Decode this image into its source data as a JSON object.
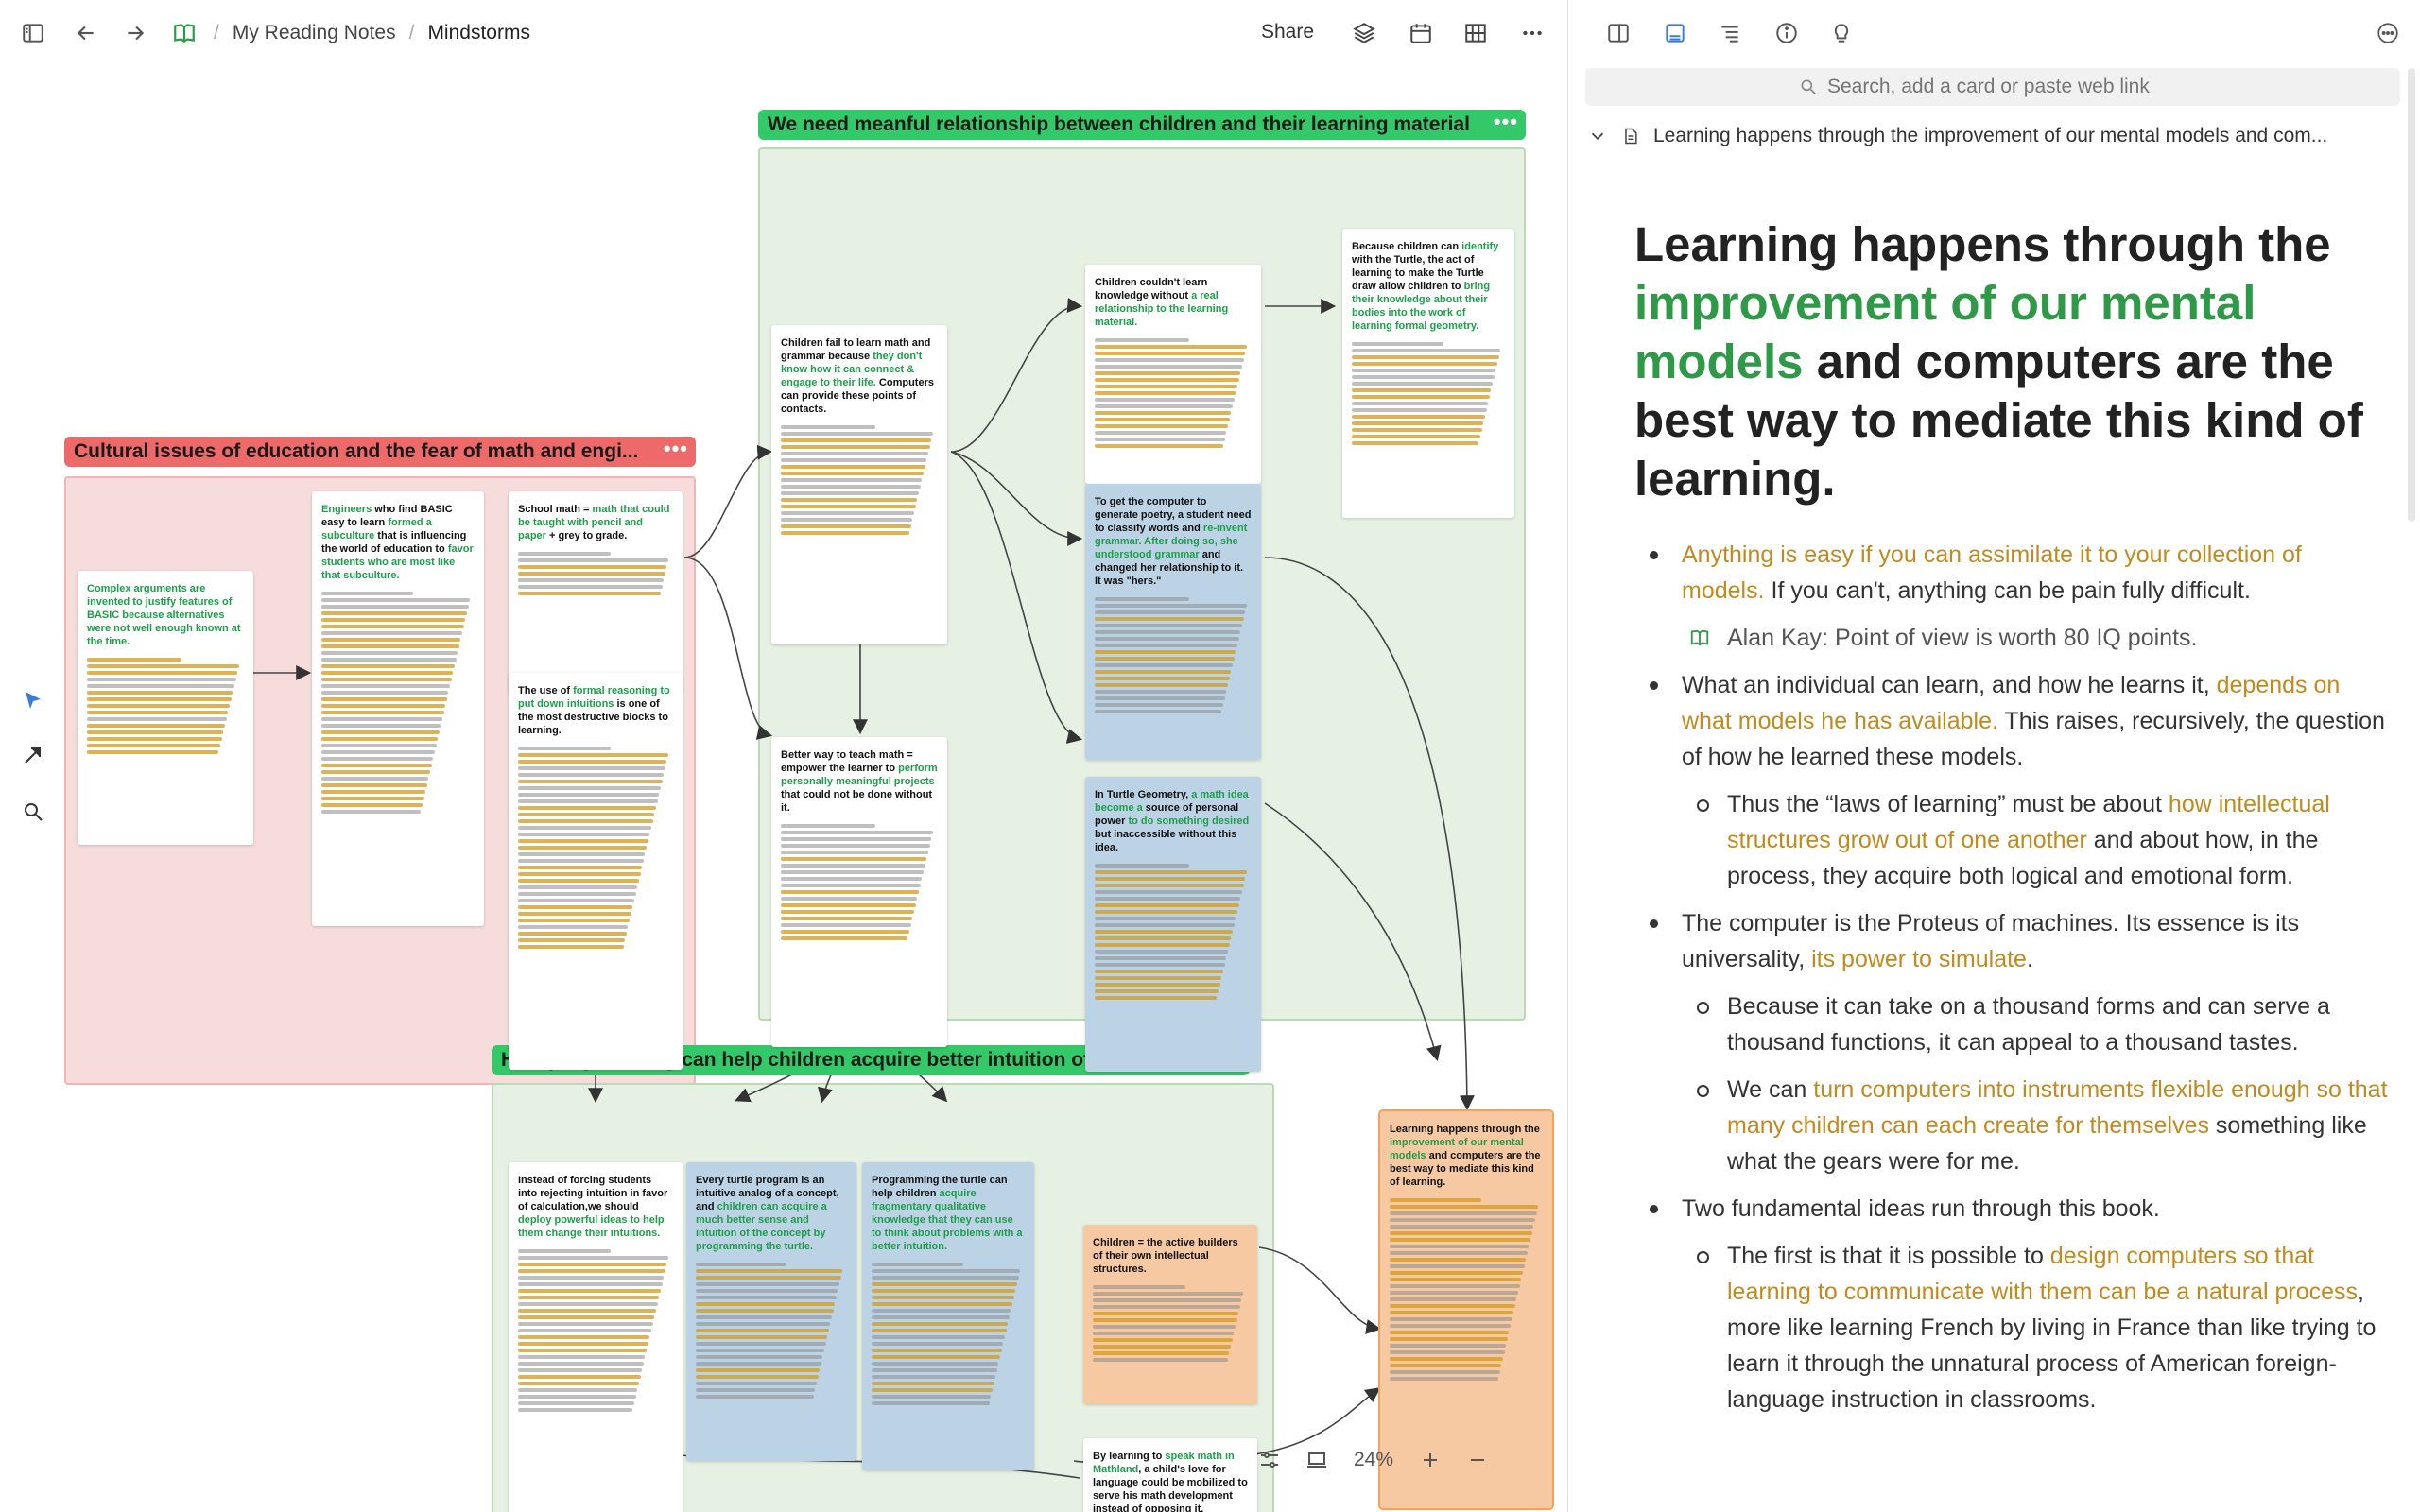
{
  "breadcrumb": {
    "root": "My Reading Notes",
    "current": "Mindstorms"
  },
  "toolbar": {
    "share_label": "Share"
  },
  "zoom": {
    "level": "24%"
  },
  "groups": {
    "relationship": "We need meanful relationship between children and their learning material",
    "cultural": "Cultural issues of education and the fear of math and engi...",
    "programming": "How programming can help children acquire better intuition of knowledge"
  },
  "cards": {
    "basic": [
      "Complex arguments are invented to justify features of BASIC because alternatives were not well enough known at the time."
    ],
    "engineers": [
      "Engineers",
      " who find BASIC easy to learn ",
      "formed a subculture",
      " that is influencing the world of education to ",
      "favor students who are most like that subculture."
    ],
    "school_math": [
      "School math = ",
      "math that could be taught with pencil and paper",
      " + grey to grade."
    ],
    "formal": [
      "The use of ",
      "formal reasoning to put down intuitions",
      " is one of the most destructive blocks to learning."
    ],
    "fail": [
      "Children fail to learn math and grammar because ",
      "they don't know how it can connect & engage to their life.",
      " Computers can provide these points of contacts."
    ],
    "better": [
      "Better way to teach math = empower the learner to ",
      "perform personally meaningful projects",
      " that could not be done without it."
    ],
    "couldnt": [
      "Children couldn't learn knowledge without ",
      "a real relationship to the learning material."
    ],
    "poetry": [
      "To get the computer to generate poetry, a student need to classify words and ",
      "re-invent grammar. After doing so, she understood grammar",
      " and changed her relationship to it. It was \"hers.\""
    ],
    "turtle_geo": [
      "In Turtle Geometry, ",
      "a math idea become a",
      " source of personal power ",
      "to do something desired",
      " but inaccessible without this idea."
    ],
    "identify": [
      "Because children can ",
      "identify",
      " with the Turtle, the act of learning to make the Turtle draw allow children to ",
      "bring their knowledge about their bodies into the work of learning formal geometry."
    ],
    "forcing": [
      "Instead of forcing students into rejecting intuition in favor of calculation,we should ",
      "deploy powerful ideas to help them change their intuitions."
    ],
    "turtle_prog": [
      "Every turtle program is an intuitive analog of a concept, and ",
      "children can acquire a much better sense and intuition of the concept by programming the turtle."
    ],
    "prog_turtle": [
      "Programming the turtle can help children ",
      "acquire fragmentary qualitative knowledge that they can use to think about problems with a better intuition."
    ],
    "builders": [
      "Children = the active builders of their own intellectual structures."
    ],
    "mathland": [
      "By learning to ",
      "speak math in Mathland",
      ", a child's love for language could be mobilized to serve his math development instead of opposing it."
    ],
    "learning_small": [
      "Learning happens through the ",
      "improvement of our mental models",
      " and computers are the best way to mediate this kind of learning."
    ]
  },
  "panel": {
    "search_placeholder": "Search, add a card or paste web link",
    "card_header": "Learning happens through the improvement of our mental models and com...",
    "title": {
      "t1": "Learning happens through the ",
      "t2": "improvement of our mental models",
      "t3": " and computers are the best way to mediate this kind of learning."
    },
    "b1": {
      "o": "Anything is easy if you can assimilate it to your collection of models.",
      "t": " If you can't, anything can be pain fully difficult."
    },
    "b1a": {
      "author": "Alan Kay",
      "t": ": Point of view is worth 80 IQ points."
    },
    "b2": {
      "t1": "What an individual can learn, and how he learns it, ",
      "o": "depends on what models he has available.",
      "t2": " This raises, recursively, the question of how he learned these models."
    },
    "b2a": {
      "t1": "Thus the “laws of learning” must be about ",
      "o": "how intellectual structures grow out of one another",
      "t2": " and about how, in the process, they acquire both logical and emotional form."
    },
    "b3": {
      "t1": "The computer is the Proteus of machines. Its essence is its universality, ",
      "o": "its power to simulate",
      "t2": "."
    },
    "b3a": {
      "t": "Because it can take on a thousand forms and can serve a thousand functions, it can appeal to a thousand tastes."
    },
    "b3b": {
      "t1": "We can ",
      "o": "turn computers into instruments flexible enough so that many children can each create for themselves",
      "t2": " something like what the gears were for me."
    },
    "b4": {
      "t": "Two fundamental ideas run through this book."
    },
    "b4a": {
      "t1": "The first is that it is possible to ",
      "o": "design computers so that learning to communicate with them can be a natural process",
      "t2": ", more like learning French by living in France than like trying to learn it through the unnatural process of American foreign-language instruction in classrooms."
    }
  },
  "colors": {
    "green_title": "#34c968",
    "red_title": "#ee6a6a",
    "green_text": "#2e9a47",
    "orange_text": "#c28a1d",
    "blue_card": "#bcd3e6",
    "orange_card": "#f7c9a3"
  }
}
